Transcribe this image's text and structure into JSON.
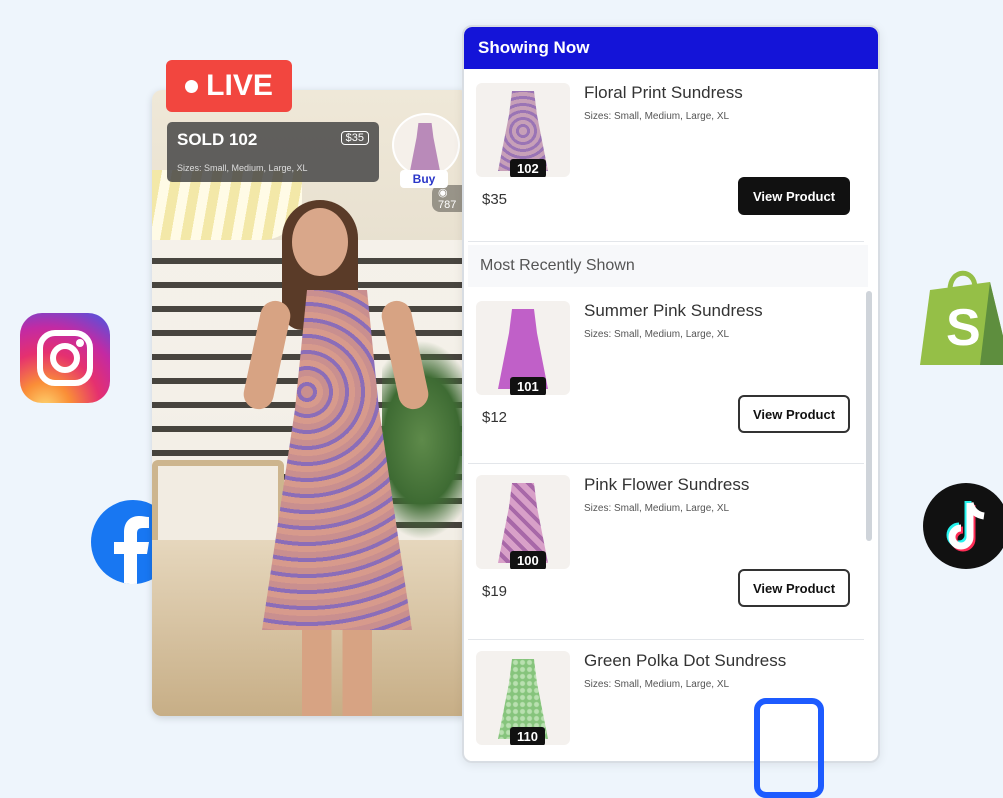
{
  "live_badge": {
    "label": "LIVE"
  },
  "stream": {
    "viewers": "787"
  },
  "sold_overlay": {
    "title": "SOLD 102",
    "price": "$35",
    "sizes": "Sizes: Small, Medium, Large, XL"
  },
  "buy_button": {
    "label": "Buy"
  },
  "panel": {
    "header": "Showing Now",
    "recent_header": "Most Recently Shown",
    "current": {
      "name": "Floral Print Sundress",
      "sizes": "Sizes: Small, Medium, Large, XL",
      "number": "102",
      "price": "$35",
      "button": "View Product"
    },
    "recent": [
      {
        "name": "Summer Pink Sundress",
        "sizes": "Sizes: Small, Medium, Large, XL",
        "number": "101",
        "price": "$12",
        "button": "View Product"
      },
      {
        "name": "Pink Flower Sundress",
        "sizes": "Sizes: Small, Medium, Large, XL",
        "number": "100",
        "price": "$19",
        "button": "View Product"
      },
      {
        "name": "Green Polka Dot Sundress",
        "sizes": "Sizes: Small, Medium, Large, XL",
        "number": "110"
      }
    ]
  },
  "social_icons": [
    "instagram-icon",
    "facebook-icon",
    "shopify-icon",
    "tiktok-icon"
  ],
  "colors": {
    "header_blue": "#1414d8",
    "live_red": "#f2463f",
    "background": "#eef5fc"
  }
}
